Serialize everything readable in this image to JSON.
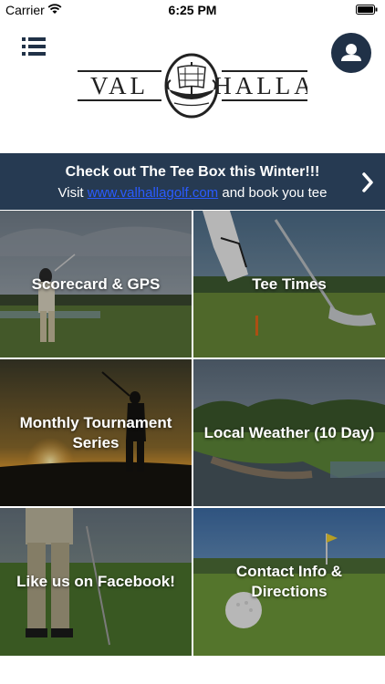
{
  "status_bar": {
    "carrier": "Carrier",
    "time": "6:25 PM",
    "icons": [
      "wifi-icon",
      "battery-icon"
    ]
  },
  "header": {
    "logo_text_left": "VAL",
    "logo_text_right": "HALLA",
    "icons": [
      "menu-icon",
      "user-icon",
      "viking-ship-icon"
    ],
    "accent_color": "#203147"
  },
  "banner": {
    "title": "Check out The Tee Box this Winter!!!",
    "sub_prefix": "Visit",
    "link": "www.valhallagolf.com",
    "sub_suffix": "and book you tee",
    "background": "#263a52",
    "link_color": "#2a5bff"
  },
  "tiles": [
    {
      "label": "Scorecard & GPS"
    },
    {
      "label": "Tee Times"
    },
    {
      "label": "Monthly Tournament Series"
    },
    {
      "label": "Local Weather (10 Day)"
    },
    {
      "label": "Like us on Facebook!"
    },
    {
      "label": "Contact Info & Directions"
    }
  ]
}
